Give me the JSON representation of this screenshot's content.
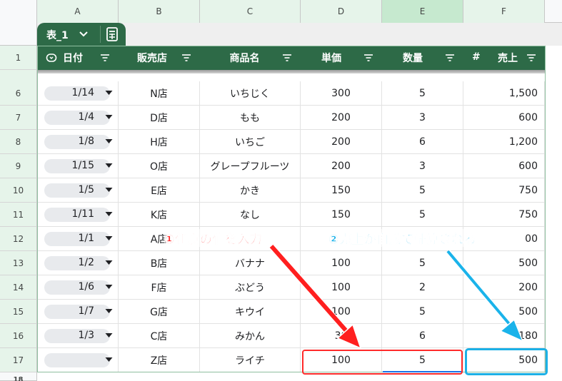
{
  "columns": [
    "A",
    "B",
    "C",
    "D",
    "E",
    "F"
  ],
  "table": {
    "name": "表_1",
    "headers": [
      "日付",
      "販売店",
      "商品名",
      "単価",
      "数量",
      "売上"
    ],
    "price_header_symbol": "#"
  },
  "row_numbers": [
    "1",
    "6",
    "7",
    "8",
    "9",
    "10",
    "11",
    "12",
    "13",
    "14",
    "15",
    "16",
    "17",
    "18"
  ],
  "rows": [
    {
      "date": "1/14",
      "store": "N店",
      "product": "いちじく",
      "price": "300",
      "qty": "5",
      "sales": "1,500"
    },
    {
      "date": "1/4",
      "store": "D店",
      "product": "もも",
      "price": "200",
      "qty": "3",
      "sales": "600"
    },
    {
      "date": "1/8",
      "store": "H店",
      "product": "いちご",
      "price": "200",
      "qty": "6",
      "sales": "1,200"
    },
    {
      "date": "1/15",
      "store": "O店",
      "product": "グレープフルーツ",
      "price": "200",
      "qty": "3",
      "sales": "600"
    },
    {
      "date": "1/5",
      "store": "E店",
      "product": "かき",
      "price": "150",
      "qty": "5",
      "sales": "750"
    },
    {
      "date": "1/11",
      "store": "K店",
      "product": "なし",
      "price": "150",
      "qty": "5",
      "sales": "750"
    },
    {
      "date": "1/1",
      "store": "A店",
      "product": "",
      "price": "",
      "qty": "",
      "sales": "00"
    },
    {
      "date": "1/2",
      "store": "B店",
      "product": "バナナ",
      "price": "100",
      "qty": "5",
      "sales": "500"
    },
    {
      "date": "1/6",
      "store": "F店",
      "product": "ぶどう",
      "price": "100",
      "qty": "2",
      "sales": "200"
    },
    {
      "date": "1/7",
      "store": "G店",
      "product": "キウイ",
      "price": "100",
      "qty": "5",
      "sales": "500"
    },
    {
      "date": "1/3",
      "store": "C店",
      "product": "みかん",
      "price": "30",
      "qty": "6",
      "sales": "180"
    },
    {
      "date": "",
      "store": "Z店",
      "product": "ライチ",
      "price": "100",
      "qty": "5",
      "sales": "500"
    }
  ],
  "annotations": {
    "step1": "①任意の値を入力",
    "step2": "②売上が自動で計算される"
  },
  "colors": {
    "table_header": "#2d6a47",
    "annotation_red": "#ff2a2a",
    "annotation_blue": "#19b2ea"
  }
}
